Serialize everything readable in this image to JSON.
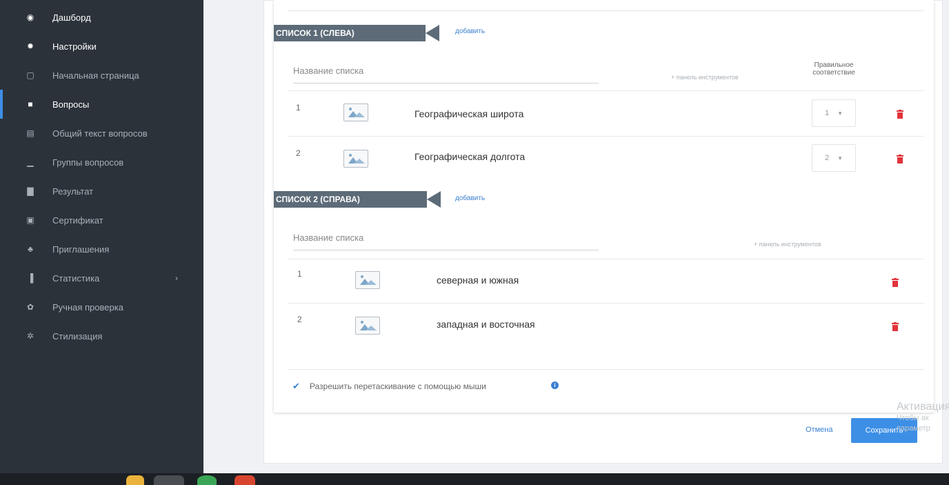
{
  "sidebar": {
    "items": [
      {
        "label": "Дашборд",
        "icon": "dashboard-icon",
        "glyph": "◉",
        "state": "bright"
      },
      {
        "label": "Настройки",
        "icon": "gear-icon",
        "glyph": "✹",
        "state": "bright"
      },
      {
        "label": "Начальная страница",
        "icon": "file-icon",
        "glyph": "▢",
        "state": "normal"
      },
      {
        "label": "Вопросы",
        "icon": "comment-icon",
        "glyph": "■",
        "state": "active"
      },
      {
        "label": "Общий текст вопросов",
        "icon": "document-icon",
        "glyph": "▤",
        "state": "normal"
      },
      {
        "label": "Группы вопросов",
        "icon": "bar-chart-icon",
        "glyph": "▁",
        "state": "normal"
      },
      {
        "label": "Результат",
        "icon": "results-icon",
        "glyph": "▇",
        "state": "normal"
      },
      {
        "label": "Сертификат",
        "icon": "certificate-icon",
        "glyph": "▣",
        "state": "normal"
      },
      {
        "label": "Приглашения",
        "icon": "users-icon",
        "glyph": "♣",
        "state": "normal"
      },
      {
        "label": "Статистика",
        "icon": "statistics-icon",
        "glyph": "▐",
        "state": "normal",
        "chevron": "›"
      },
      {
        "label": "Ручная проверка",
        "icon": "check-gear-icon",
        "glyph": "✿",
        "state": "normal"
      },
      {
        "label": "Стилизация",
        "icon": "style-icon",
        "glyph": "✲",
        "state": "normal"
      }
    ]
  },
  "list_left": {
    "title": "СПИСОК 1 (СЛЕВА)",
    "add_label": "добавить",
    "column_name": "Название списка",
    "toolbar_link": "+ панель инструментов",
    "correct_header": "Правильное соответствие",
    "rows": [
      {
        "num": "1",
        "text": "Географическая широта",
        "select": "1"
      },
      {
        "num": "2",
        "text": "Географическая долгота",
        "select": "2"
      }
    ]
  },
  "list_right": {
    "title": "СПИСОК 2 (СПРАВА)",
    "add_label": "добавить",
    "column_name": "Название списка",
    "toolbar_link": "+ панель инструментов",
    "rows": [
      {
        "num": "1",
        "text": "северная и южная"
      },
      {
        "num": "2",
        "text": "западная и восточная"
      }
    ]
  },
  "options": {
    "drag_label": "Разрешить перетаскивание с помощью мыши",
    "info_glyph": "i"
  },
  "footer": {
    "cancel_label": "Отмена",
    "save_label": "Сохранить"
  },
  "watermark": {
    "line1": "Активация",
    "line2": "Чтобы ак",
    "line3": "параметр"
  },
  "colors": {
    "sidebar_bg": "#2b323a",
    "accent": "#3d8fe6",
    "delete": "#e2333b",
    "section_tab": "#5d6b78"
  }
}
